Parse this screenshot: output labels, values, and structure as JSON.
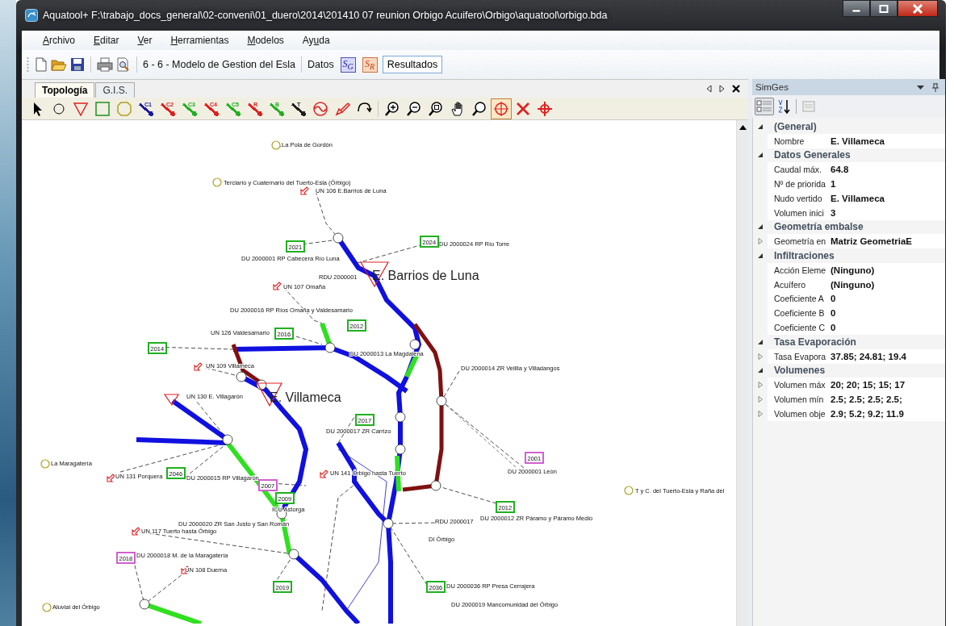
{
  "window": {
    "title": "Aquatool+ F:\\trabajo_docs_general\\02-conveni\\01_duero\\2014\\201410 07 reunion Orbigo Acuifero\\Orbigo\\aquatool\\orbigo.bda"
  },
  "menu": [
    {
      "mnemonic": "A",
      "post": "rchivo"
    },
    {
      "mnemonic": "E",
      "post": "ditar"
    },
    {
      "mnemonic": "V",
      "post": "er"
    },
    {
      "mnemonic": "H",
      "post": "erramientas"
    },
    {
      "mnemonic": "M",
      "post": "odelos"
    },
    {
      "pre": "Ay",
      "mnemonic": "u",
      "post": "da"
    }
  ],
  "toolbar": {
    "model": "6 - 6 - Modelo de Gestion del Esla",
    "data_label": "Datos",
    "sg": "S$_{G}$",
    "sr": "S$_{R}$",
    "results": "Resultados"
  },
  "tabs": [
    {
      "label": "Topología",
      "selected": true
    },
    {
      "label": "G.I.S.",
      "selected": false
    }
  ],
  "tools": [
    {
      "kind": "pointer",
      "selected": false
    },
    {
      "kind": "node",
      "selected": false
    },
    {
      "kind": "reservoir",
      "selected": false
    },
    {
      "kind": "demand",
      "selected": false
    },
    {
      "kind": "aquifer",
      "selected": false
    },
    {
      "kind": "conduit",
      "label": "C1",
      "color": "#1a1aa0",
      "selected": false
    },
    {
      "kind": "conduit",
      "label": "C2",
      "color": "#e02020",
      "selected": false
    },
    {
      "kind": "conduit",
      "label": "C3",
      "color": "#20b020",
      "selected": false
    },
    {
      "kind": "conduit",
      "label": "C4",
      "color": "#e02020",
      "selected": false
    },
    {
      "kind": "conduit",
      "label": "C5",
      "color": "#20b020",
      "selected": false
    },
    {
      "kind": "conduit",
      "label": "R",
      "color": "#e02020",
      "selected": false
    },
    {
      "kind": "conduit",
      "label": "B",
      "color": "#20b020",
      "selected": false
    },
    {
      "kind": "conduit",
      "label": "T",
      "color": "#202020",
      "selected": false
    },
    {
      "kind": "hydro",
      "selected": false
    },
    {
      "kind": "return",
      "selected": false
    },
    {
      "kind": "curve",
      "selected": false
    },
    {
      "kind": "zoom-in",
      "selected": false
    },
    {
      "kind": "zoom-out",
      "selected": false
    },
    {
      "kind": "zoom-fit",
      "selected": false
    },
    {
      "kind": "pan",
      "selected": false
    },
    {
      "kind": "zoom",
      "selected": false
    },
    {
      "kind": "target",
      "selected": true
    },
    {
      "kind": "delete",
      "selected": false
    },
    {
      "kind": "crosshair",
      "selected": false
    }
  ],
  "diagram": {
    "reservoirs": [
      "E. Barrios de Luna",
      "E. Villameca"
    ],
    "labels": [
      "La Pola de Gordón",
      "Terciario y Cuaternario del Tuerto-Esla (Órbigo)",
      "UN 106 E.Barrios de Luna",
      "DU 2000001 RP Cabecera Río Luna",
      "DU 2000024 RP Río Torre",
      "UN 107 Omaña",
      "RDU 2000001",
      "DU 2000016 RP Ríos Omaña y Valdesamario",
      "UN 126 Valdesamario",
      "DU 2000013 La Magdalena",
      "UN 109 Villameca",
      "UN 130 E. Villagarón",
      "La Maragatería",
      "UN 131 Porquera",
      "DU 2000015 RP Villagarón",
      "ICU Astorga",
      "DU 2000020 ZR San Justo y San Román",
      "UN 117 Tuerto hasta Órbigo",
      "DU 2000018 M. de la Maragatería",
      "UN 108 Duerna",
      "Aluvial del Órbigo",
      "DU 2000014 ZR Velilla y Villadangos",
      "DU 2000017 ZR Carrizo",
      "UN 141 Órbigo hasta Tuerto",
      "DU 2000001 León",
      "T y C. del Tuerto-Esla y Raña del",
      "DU 2000012 ZR Páramo y Páramo Medio",
      "RDU 2000017",
      "DI Órbigo",
      "DU 2000036 RP Presa Cerrajera",
      "DU 2000019 Mancomunidad del Órbigo"
    ],
    "boxes": [
      {
        "label": "2021",
        "color": "#20b020"
      },
      {
        "label": "2024",
        "color": "#20b020"
      },
      {
        "label": "2012",
        "color": "#20b020"
      },
      {
        "label": "2016",
        "color": "#20b020"
      },
      {
        "label": "2014",
        "color": "#20b020"
      },
      {
        "label": "2017",
        "color": "#20b020"
      },
      {
        "label": "2001",
        "color": "#d060d0"
      },
      {
        "label": "2012",
        "color": "#20b020"
      },
      {
        "label": "2019",
        "color": "#20b020"
      },
      {
        "label": "2036",
        "color": "#20b020"
      },
      {
        "label": "2007",
        "color": "#d060d0"
      },
      {
        "label": "2009",
        "color": "#20b020"
      },
      {
        "label": "2046",
        "color": "#20b020"
      },
      {
        "label": "2018",
        "color": "#d060d0"
      }
    ]
  },
  "panel": {
    "title": "SimGes",
    "rows": [
      {
        "kind": "category",
        "label": "(General)",
        "expanded": true
      },
      {
        "kind": "property",
        "label": "Nombre",
        "value": "E. Villameca"
      },
      {
        "kind": "category",
        "label": "Datos Generales",
        "expanded": true
      },
      {
        "kind": "property",
        "label": "Caudal máx.",
        "value": "64.8"
      },
      {
        "kind": "property",
        "label": "Nº de priorida",
        "value": "1"
      },
      {
        "kind": "property",
        "label": "Nudo vertido",
        "value": "E. Villameca"
      },
      {
        "kind": "property",
        "label": "Volumen inici",
        "value": "3"
      },
      {
        "kind": "category",
        "label": "Geometría embalse",
        "expanded": true
      },
      {
        "kind": "group",
        "label": "Geometría en",
        "value": "Matriz GeometriaE",
        "expanded": false
      },
      {
        "kind": "category",
        "label": "Infiltraciones",
        "expanded": true
      },
      {
        "kind": "property",
        "label": "Acción Eleme",
        "value": "(Ninguno)"
      },
      {
        "kind": "property",
        "label": "Acuífero",
        "value": "(Ninguno)"
      },
      {
        "kind": "property",
        "label": "Coeficiente A",
        "value": "0"
      },
      {
        "kind": "property",
        "label": "Coeficiente B",
        "value": "0"
      },
      {
        "kind": "property",
        "label": "Coeficiente C",
        "value": "0"
      },
      {
        "kind": "category",
        "label": "Tasa Evaporación",
        "expanded": true
      },
      {
        "kind": "group",
        "label": "Tasa Evapora",
        "value": "37.85; 24.81; 19.4",
        "expanded": false
      },
      {
        "kind": "category",
        "label": "Volumenes",
        "expanded": true
      },
      {
        "kind": "group",
        "label": "Volumen máx",
        "value": "20; 20; 15; 15; 17",
        "expanded": false
      },
      {
        "kind": "group",
        "label": "Volumen mín",
        "value": "2.5; 2.5; 2.5; 2.5;",
        "expanded": false
      },
      {
        "kind": "group",
        "label": "Volumen obje",
        "value": "2.9; 5.2; 9.2; 11.9",
        "expanded": false
      }
    ]
  }
}
